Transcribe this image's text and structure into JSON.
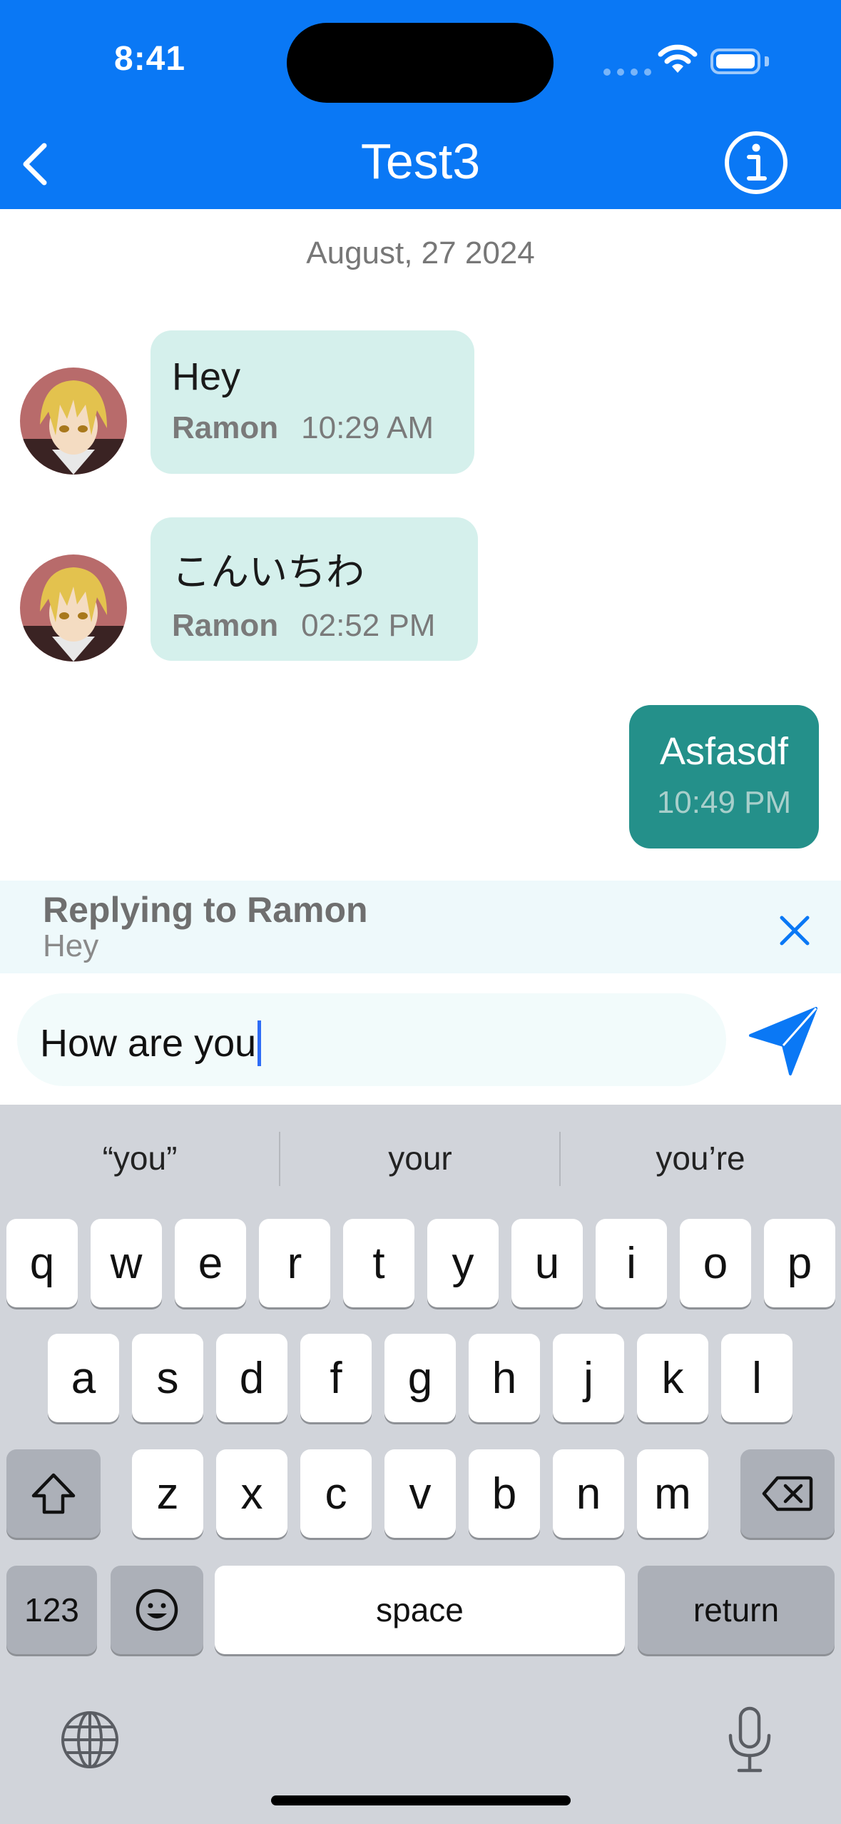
{
  "status_bar": {
    "time": "8:41"
  },
  "header": {
    "title": "Test3"
  },
  "chat": {
    "date": "August, 27 2024",
    "messages": [
      {
        "direction": "incoming",
        "text": "Hey",
        "sender": "Ramon",
        "time": "10:29 AM"
      },
      {
        "direction": "incoming",
        "text": "こんいちわ",
        "sender": "Ramon",
        "time": "02:52 PM"
      },
      {
        "direction": "outgoing",
        "text": "Asfasdf",
        "time": "10:49 PM"
      }
    ]
  },
  "reply": {
    "title": "Replying to Ramon",
    "quote": "Hey"
  },
  "composer": {
    "value": "How are you"
  },
  "keyboard": {
    "suggestions": [
      "“you”",
      "your",
      "you’re"
    ],
    "row1": [
      "q",
      "w",
      "e",
      "r",
      "t",
      "y",
      "u",
      "i",
      "o",
      "p"
    ],
    "row2": [
      "a",
      "s",
      "d",
      "f",
      "g",
      "h",
      "j",
      "k",
      "l"
    ],
    "row3": [
      "z",
      "x",
      "c",
      "v",
      "b",
      "n",
      "m"
    ],
    "numbers_label": "123",
    "space_label": "space",
    "return_label": "return"
  },
  "colors": {
    "header": "#0a78f5",
    "incoming_bubble": "#d5f0ec",
    "outgoing_bubble": "#24908a",
    "send": "#0a78f5"
  }
}
